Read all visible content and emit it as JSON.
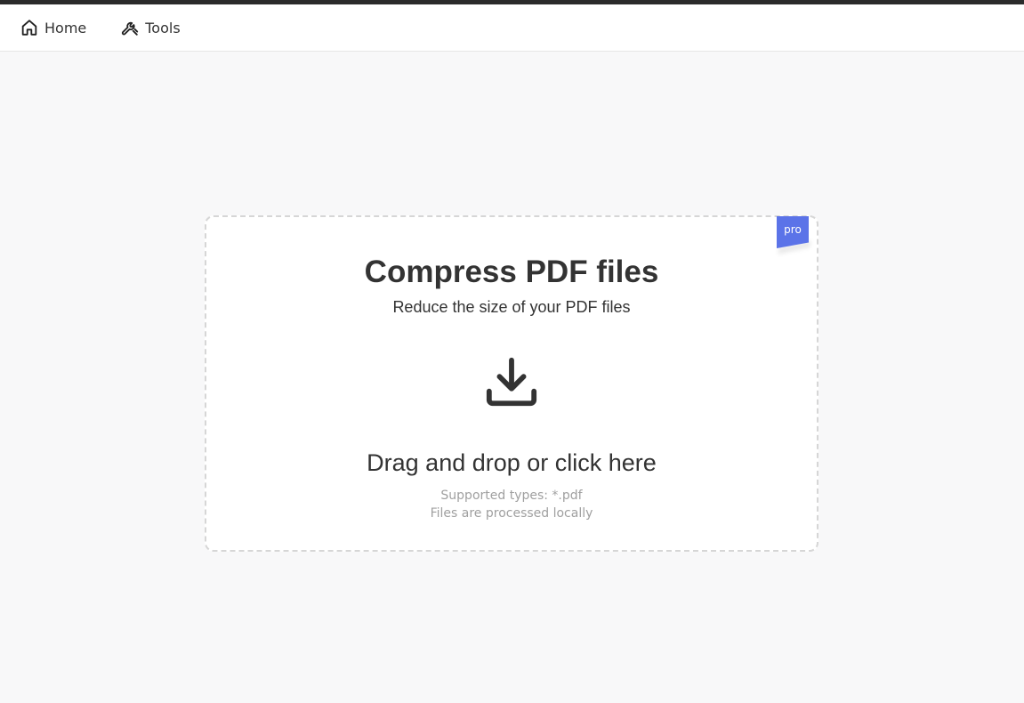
{
  "nav": {
    "items": [
      {
        "label": "Home",
        "icon": "home-icon"
      },
      {
        "label": "Tools",
        "icon": "wrench-icon"
      }
    ]
  },
  "dropzone": {
    "badge": "pro",
    "title": "Compress PDF files",
    "subtitle": "Reduce the size of your PDF files",
    "icon": "download-icon",
    "prompt": "Drag and drop or click here",
    "supported_types": "Supported types: *.pdf",
    "note": "Files are processed locally"
  },
  "colors": {
    "accent": "#5b73e8",
    "text": "#333333",
    "muted": "#a0a0a0",
    "background": "#f8f8f9"
  }
}
